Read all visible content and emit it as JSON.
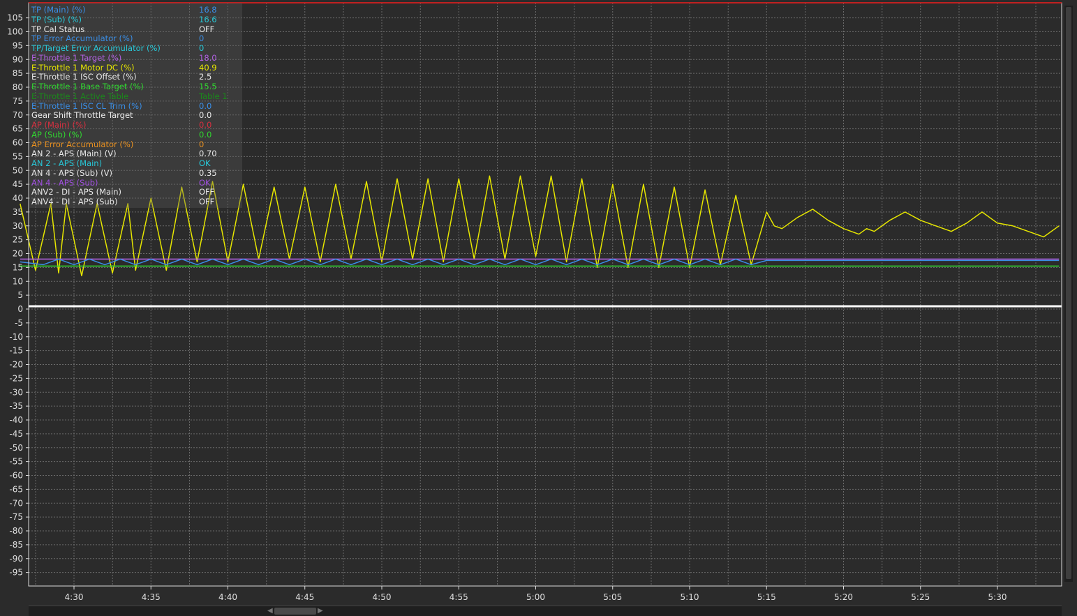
{
  "chart_data": {
    "type": "line",
    "title": "",
    "xlabel": "",
    "ylabel": "",
    "ylim": [
      -100,
      110
    ],
    "yticks": [
      105,
      100,
      95,
      90,
      85,
      80,
      75,
      70,
      65,
      60,
      55,
      50,
      45,
      40,
      35,
      30,
      25,
      20,
      15,
      10,
      5,
      0,
      -5,
      -10,
      -15,
      -20,
      -25,
      -30,
      -35,
      -40,
      -45,
      -50,
      -55,
      -60,
      -65,
      -70,
      -75,
      -80,
      -85,
      -90,
      -95
    ],
    "xticks": [
      "4:30",
      "4:35",
      "4:40",
      "4:45",
      "4:50",
      "4:55",
      "5:00",
      "5:05",
      "5:10",
      "5:15",
      "5:20",
      "5:25",
      "5:30"
    ],
    "xlim": [
      "4:26.5",
      "5:34"
    ],
    "grid": true,
    "series": [
      {
        "name": "E-Throttle 1 Motor DC (%)",
        "color": "#e6e600",
        "x": [
          "4:26.5",
          "4:27.5",
          "4:28.5",
          "4:29",
          "4:29.5",
          "4:30.5",
          "4:31.5",
          "4:32.5",
          "4:33.5",
          "4:34",
          "4:35",
          "4:36",
          "4:37",
          "4:38",
          "4:39",
          "4:40",
          "4:41",
          "4:42",
          "4:43",
          "4:44",
          "4:45",
          "4:46",
          "4:47",
          "4:48",
          "4:49",
          "4:50",
          "4:51",
          "4:52",
          "4:53",
          "4:54",
          "4:55",
          "4:56",
          "4:57",
          "4:58",
          "4:59",
          "5:00",
          "5:01",
          "5:02",
          "5:03",
          "5:04",
          "5:05",
          "5:06",
          "5:07",
          "5:08",
          "5:09",
          "5:10",
          "5:11",
          "5:12",
          "5:13",
          "5:14",
          "5:15",
          "5:15.5",
          "5:16",
          "5:17",
          "5:18",
          "5:19",
          "5:20",
          "5:21",
          "5:21.5",
          "5:22",
          "5:23",
          "5:24",
          "5:25",
          "5:26",
          "5:27",
          "5:28",
          "5:29",
          "5:30",
          "5:31",
          "5:32",
          "5:33",
          "5:34"
        ],
        "values": [
          38,
          14,
          38,
          13,
          38,
          12,
          38,
          13,
          38,
          14,
          40,
          14,
          44,
          17,
          46,
          17,
          45,
          18,
          44,
          18,
          44,
          17,
          45,
          18,
          46,
          17,
          47,
          18,
          47,
          17,
          47,
          18,
          48,
          18,
          48,
          19,
          48,
          17,
          47,
          15,
          45,
          15,
          45,
          15,
          44,
          15,
          43,
          16,
          41,
          16,
          35,
          30,
          29,
          33,
          36,
          32,
          29,
          27,
          29,
          28,
          32,
          35,
          32,
          30,
          28,
          31,
          35,
          31,
          30,
          28,
          26,
          30
        ]
      },
      {
        "name": "E-Throttle 1 Target (%)",
        "color": "#b060e0",
        "x": [
          "4:26.5",
          "5:34"
        ],
        "values": [
          18,
          18
        ]
      },
      {
        "name": "TP (Main) (%)",
        "color": "#3a8ee6",
        "x": [
          "4:26.5",
          "4:28",
          "4:29",
          "4:30",
          "4:31",
          "4:32",
          "4:33",
          "4:34",
          "4:35",
          "4:36",
          "4:37",
          "4:38",
          "4:39",
          "4:40",
          "4:41",
          "4:42",
          "4:43",
          "4:44",
          "4:45",
          "4:46",
          "4:47",
          "4:48",
          "4:49",
          "4:50",
          "4:51",
          "4:52",
          "4:53",
          "4:54",
          "4:55",
          "4:56",
          "4:57",
          "4:58",
          "4:59",
          "5:00",
          "5:01",
          "5:02",
          "5:03",
          "5:04",
          "5:05",
          "5:06",
          "5:07",
          "5:08",
          "5:09",
          "5:10",
          "5:11",
          "5:12",
          "5:13",
          "5:14",
          "5:15",
          "5:34"
        ],
        "values": [
          17,
          16,
          18,
          16,
          18,
          16,
          18,
          16,
          18,
          16,
          18,
          16,
          18,
          16,
          18,
          16,
          18,
          16,
          18,
          16,
          18,
          16,
          18,
          16,
          18,
          16,
          18,
          16,
          18,
          16,
          18,
          16,
          18,
          16,
          18,
          16,
          18,
          16,
          18,
          16,
          18,
          16,
          18,
          16,
          18,
          16,
          18,
          16,
          17.5,
          17.5
        ]
      },
      {
        "name": "AP (Sub) (%)",
        "color": "#30d830",
        "x": [
          "4:26.5",
          "5:34"
        ],
        "values": [
          15.5,
          15.5
        ]
      }
    ],
    "legend": [
      {
        "label": "TP (Main) (%)",
        "value": "16.8",
        "color": "#3a8ee6"
      },
      {
        "label": "TP (Sub) (%)",
        "value": "16.6",
        "color": "#28c8d8"
      },
      {
        "label": "TP Cal Status",
        "value": "OFF",
        "color": "#e8e8e8"
      },
      {
        "label": "TP Error Accumulator (%)",
        "value": "0",
        "color": "#3a8ee6"
      },
      {
        "label": "TP/Target Error Accumulator (%)",
        "value": "0",
        "color": "#28c8d8"
      },
      {
        "label": "E-Throttle 1 Target (%)",
        "value": "18.0",
        "color": "#b060e0"
      },
      {
        "label": "E-Throttle 1 Motor DC (%)",
        "value": "40.9",
        "color": "#e6e600"
      },
      {
        "label": "E-Throttle 1 ISC Offset (%)",
        "value": "2.5",
        "color": "#e8e8e8"
      },
      {
        "label": "E-Throttle 1 Base Target  (%)",
        "value": "15.5",
        "color": "#30d830"
      },
      {
        "label": "E-Throttle 1 Active Table",
        "value": "Table 1",
        "color": "#1a8a1a"
      },
      {
        "label": "E-Throttle 1 ISC CL Trim (%)",
        "value": "0.0",
        "color": "#3a8ee6"
      },
      {
        "label": "Gear Shift Throttle Target",
        "value": "0.0",
        "color": "#e8e8e8"
      },
      {
        "label": "AP (Main) (%)",
        "value": "0.0",
        "color": "#d83040"
      },
      {
        "label": "AP (Sub) (%)",
        "value": "0.0",
        "color": "#30d830"
      },
      {
        "label": "AP Error Accumulator (%)",
        "value": "0",
        "color": "#e89020"
      },
      {
        "label": "AN 2 - APS (Main) (V)",
        "value": "0.70",
        "color": "#e8e8e8"
      },
      {
        "label": "AN 2 - APS (Main)",
        "value": "OK",
        "color": "#28c8d8"
      },
      {
        "label": "AN 4 - APS (Sub) (V)",
        "value": "0.35",
        "color": "#e8e8e8"
      },
      {
        "label": "AN 4 - APS (Sub)",
        "value": "OK",
        "color": "#a050e0"
      },
      {
        "label": "ANV2 - DI  - APS (Main)",
        "value": "OFF",
        "color": "#e8e8e8"
      },
      {
        "label": "ANV4 - DI  - APS (Sub)",
        "value": "OFF",
        "color": "#e8e8e8"
      }
    ]
  },
  "colors": {
    "background": "#2b2b2b",
    "grid": "#6a6a6a",
    "zero_line": "#ffffff",
    "frame_top": "#c02020",
    "axis_text": "#e0e0e0"
  }
}
